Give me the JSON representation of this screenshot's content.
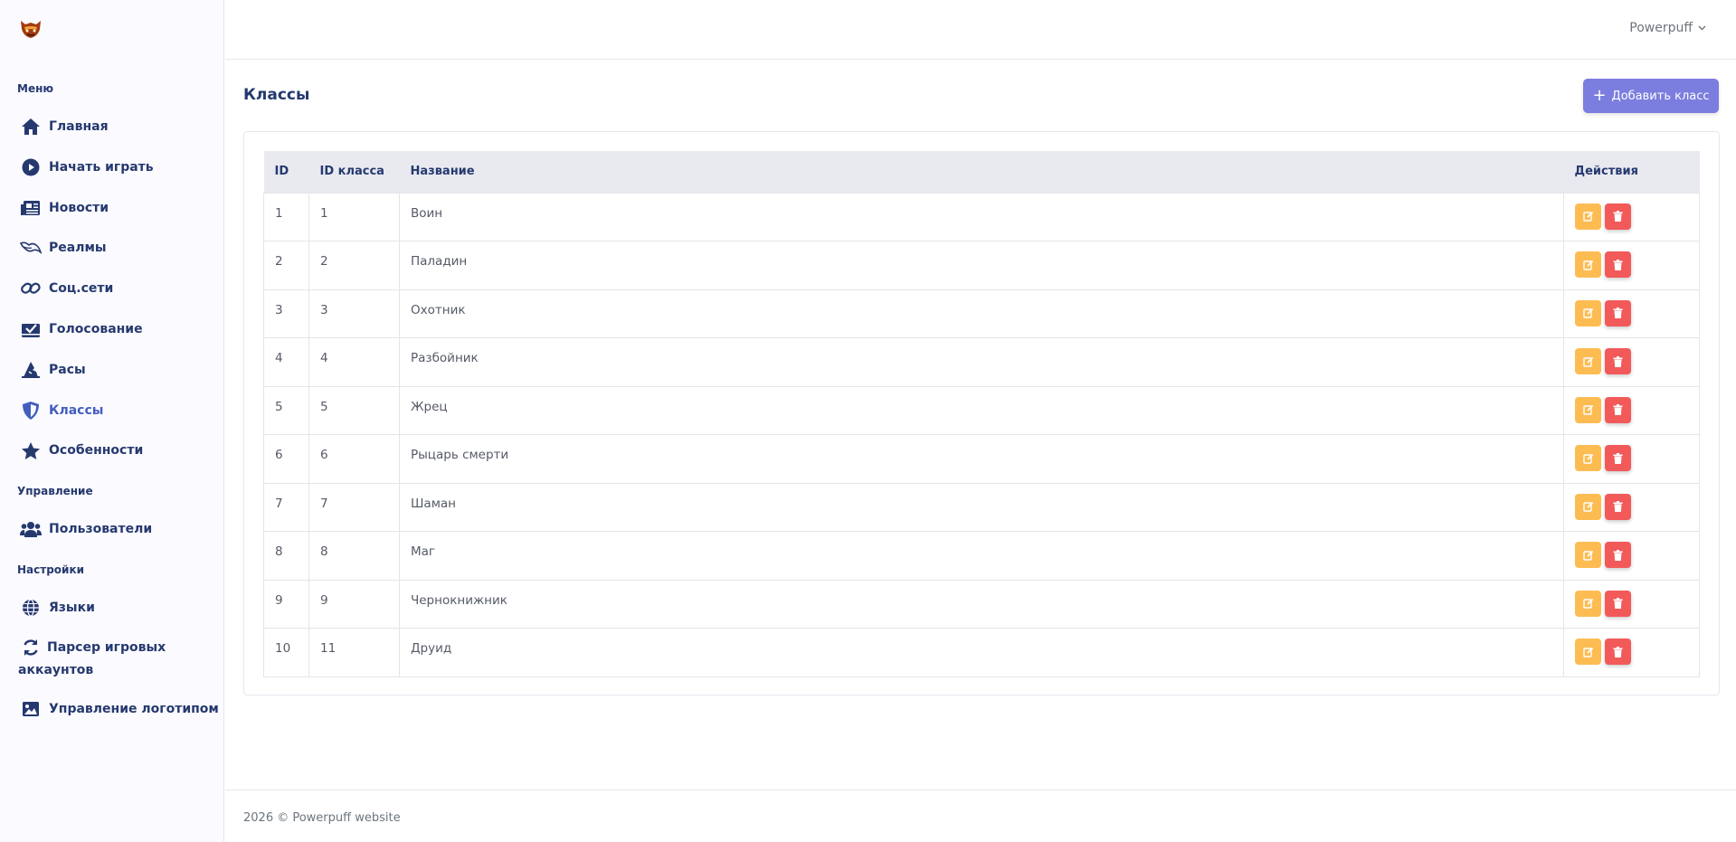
{
  "sidebar": {
    "sections": {
      "menu": "Меню",
      "management": "Управление",
      "settings": "Настройки"
    },
    "items": [
      {
        "label": "Главная",
        "icon": "home-icon"
      },
      {
        "label": "Начать играть",
        "icon": "play-circle-icon"
      },
      {
        "label": "Новости",
        "icon": "newspaper-icon"
      },
      {
        "label": "Реалмы",
        "icon": "dragon-icon"
      },
      {
        "label": "Соц.сети",
        "icon": "link-icon"
      },
      {
        "label": "Голосование",
        "icon": "vote-box-icon"
      },
      {
        "label": "Расы",
        "icon": "wizard-hat-icon"
      },
      {
        "label": "Классы",
        "icon": "shield-icon",
        "active": true
      },
      {
        "label": "Особенности",
        "icon": "star-icon"
      },
      {
        "label": "Пользователи",
        "icon": "users-icon"
      },
      {
        "label": "Языки",
        "icon": "globe-icon"
      },
      {
        "label": "Парсер игровых аккаунтов",
        "icon": "sync-icon"
      },
      {
        "label": "Управление логотипом",
        "icon": "image-icon"
      }
    ]
  },
  "header": {
    "user": "Powerpuff"
  },
  "page": {
    "title": "Классы",
    "add_button": "Добавить класс"
  },
  "table": {
    "headers": [
      "ID",
      "ID класса",
      "Название",
      "Действия"
    ],
    "rows": [
      {
        "id": "1",
        "class_id": "1",
        "name": "Воин"
      },
      {
        "id": "2",
        "class_id": "2",
        "name": "Паладин"
      },
      {
        "id": "3",
        "class_id": "3",
        "name": "Охотник"
      },
      {
        "id": "4",
        "class_id": "4",
        "name": "Разбойник"
      },
      {
        "id": "5",
        "class_id": "5",
        "name": "Жрец"
      },
      {
        "id": "6",
        "class_id": "6",
        "name": "Рыцарь смерти"
      },
      {
        "id": "7",
        "class_id": "7",
        "name": "Шаман"
      },
      {
        "id": "8",
        "class_id": "8",
        "name": "Маг"
      },
      {
        "id": "9",
        "class_id": "9",
        "name": "Чернокнижник"
      },
      {
        "id": "10",
        "class_id": "11",
        "name": "Друид"
      }
    ]
  },
  "footer": {
    "text": "2026 © Powerpuff website"
  },
  "colors": {
    "primary": "#7b7ddf",
    "edit": "#fdbc52",
    "delete": "#f25a5a",
    "text": "#25396f"
  }
}
